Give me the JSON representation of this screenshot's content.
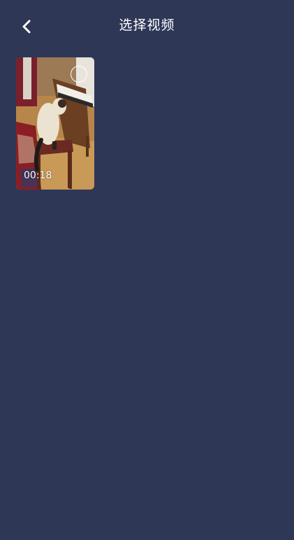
{
  "header": {
    "title": "选择视频",
    "back_icon": "chevron-left-icon"
  },
  "videos": [
    {
      "duration": "00:18",
      "selected": false,
      "select_icon": "radio-circle-icon"
    }
  ],
  "colors": {
    "background": "#2f3757",
    "text": "#ffffff"
  }
}
